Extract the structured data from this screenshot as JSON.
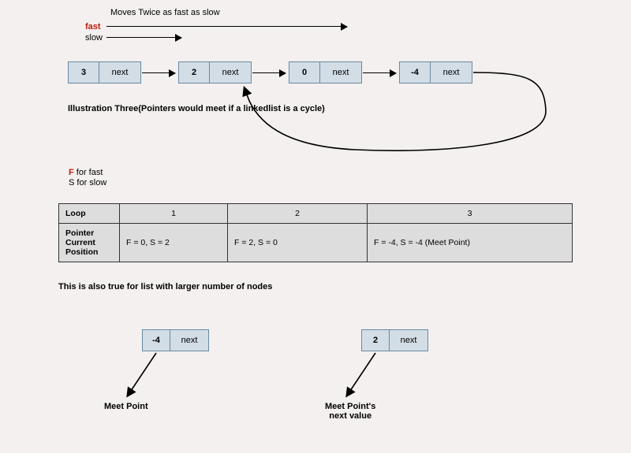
{
  "top": {
    "title": "Moves Twice as fast as slow",
    "fast_label": "fast",
    "slow_label": "slow",
    "caption": "Illustration Three(Pointers would meet if a linkedlist is a cycle)"
  },
  "legend": {
    "f_letter": "F",
    "f_rest": " for fast",
    "s_line": "S for slow"
  },
  "nodes": [
    {
      "value": "3",
      "next": "next"
    },
    {
      "value": "2",
      "next": "next"
    },
    {
      "value": "0",
      "next": "next"
    },
    {
      "value": "-4",
      "next": "next"
    }
  ],
  "table": {
    "row1_label": "Loop",
    "row2_label": "Pointer\nCurrent\nPosition",
    "cols": [
      "1",
      "2",
      "3"
    ],
    "cells": [
      "F = 0, S = 2",
      "F = 2, S = 0",
      "F = -4, S = -4  (Meet Point)"
    ]
  },
  "footer": {
    "note": "This is also true for list with larger number of nodes",
    "left_node": {
      "value": "-4",
      "next": "next"
    },
    "right_node": {
      "value": "2",
      "next": "next"
    },
    "left_caption": "Meet Point",
    "right_caption_l1": "Meet Point's",
    "right_caption_l2": "next value"
  }
}
